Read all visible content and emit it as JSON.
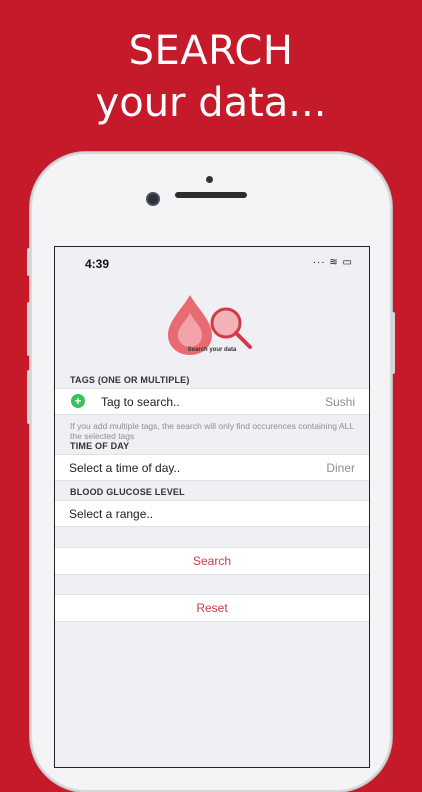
{
  "promo": {
    "line1": "SEARCH",
    "line2": "your data..."
  },
  "status_bar": {
    "time": "4:39",
    "icons": "···  ≋  ▭"
  },
  "logo": {
    "caption": "Search your data"
  },
  "tags": {
    "label": "TAGS (ONE OR MULTIPLE)",
    "field_text": "Tag to search..",
    "value": "Sushi",
    "note": "If you add multiple tags, the search will only find occurences containing ALL the selected tags"
  },
  "time_of_day": {
    "label": "TIME OF DAY",
    "field_text": "Select a time of day..",
    "value": "Diner"
  },
  "glucose": {
    "label": "BLOOD GLUCOSE LEVEL",
    "field_text": "Select a range.."
  },
  "actions": {
    "search": "Search",
    "reset": "Reset"
  },
  "colors": {
    "background": "#c41a2a",
    "accent": "#d23a4a",
    "add_green": "#35c35a"
  }
}
